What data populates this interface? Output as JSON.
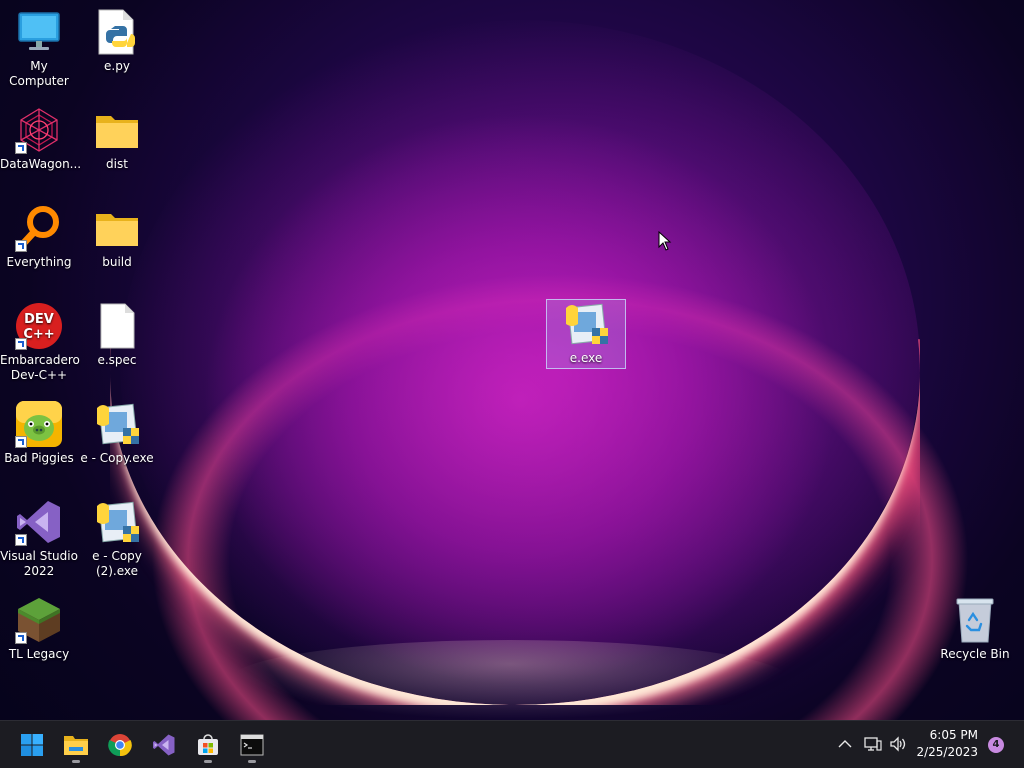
{
  "desktop": {
    "icons_col1": [
      {
        "label": "My Computer"
      },
      {
        "label": "DataWagon..."
      },
      {
        "label": "Everything"
      },
      {
        "label": "Embarcadero Dev-C++"
      },
      {
        "label": "Bad Piggies"
      },
      {
        "label": "Visual Studio 2022"
      },
      {
        "label": "TL Legacy"
      }
    ],
    "icons_col2": [
      {
        "label": "e.py"
      },
      {
        "label": "dist"
      },
      {
        "label": "build"
      },
      {
        "label": "e.spec"
      },
      {
        "label": "e - Copy.exe"
      },
      {
        "label": "e - Copy (2).exe"
      }
    ],
    "selected_icon": {
      "label": "e.exe"
    },
    "recycle_bin": {
      "label": "Recycle Bin"
    },
    "devcpp_badge_line1": "DEV",
    "devcpp_badge_line2": "C++"
  },
  "taskbar": {
    "pinned": [
      {
        "name": "start-button",
        "icon": "windows-logo-icon"
      },
      {
        "name": "file-explorer",
        "icon": "folder-icon"
      },
      {
        "name": "chrome",
        "icon": "chrome-icon"
      },
      {
        "name": "visual-studio",
        "icon": "visual-studio-icon"
      },
      {
        "name": "microsoft-store",
        "icon": "store-icon"
      },
      {
        "name": "terminal",
        "icon": "terminal-icon"
      }
    ],
    "clock": {
      "time": "6:05 PM",
      "date": "2/25/2023"
    },
    "notification_count": "4",
    "tray_icons": [
      "chevron-up-icon",
      "network-icon",
      "volume-icon"
    ]
  },
  "colors": {
    "taskbar_bg": "#1c1c22",
    "accent": "#0a7cd8",
    "wallpaper_dark": "#0b0422",
    "wallpaper_magenta": "#c81ec8"
  }
}
